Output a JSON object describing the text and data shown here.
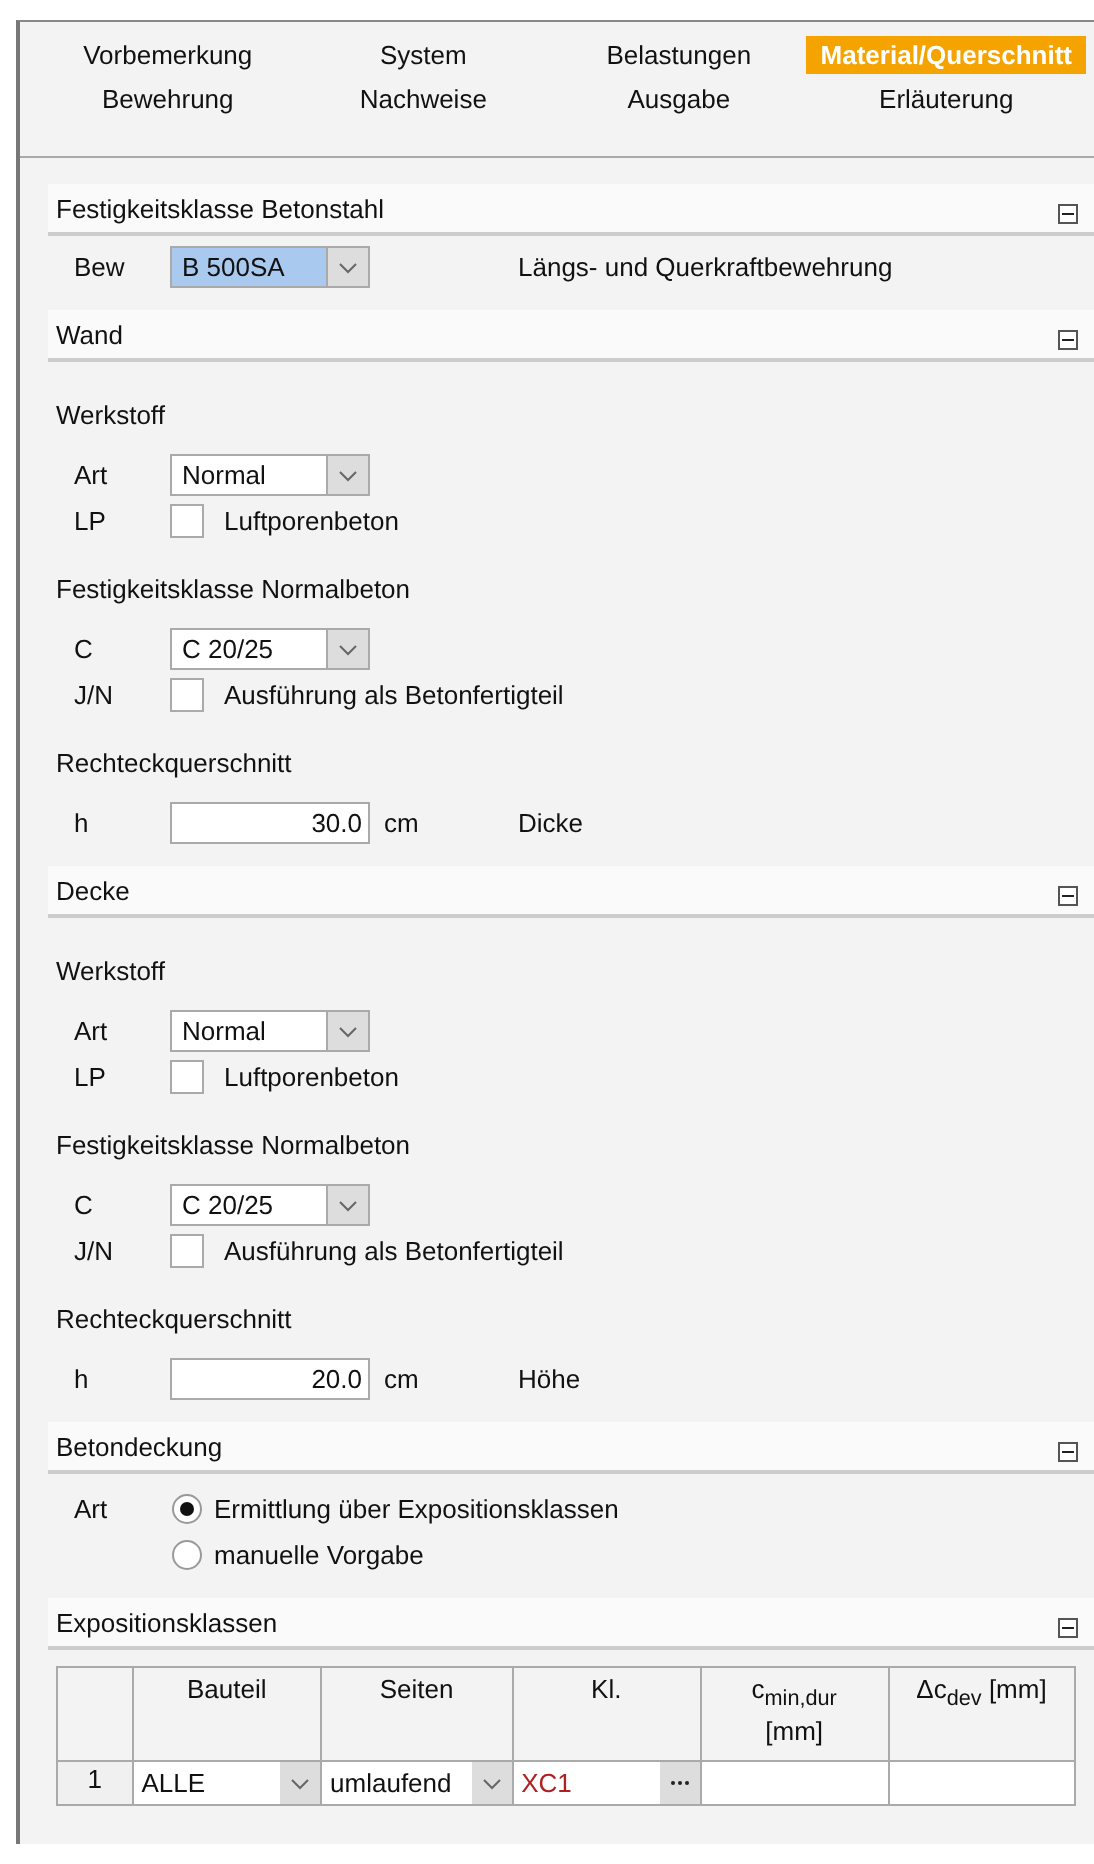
{
  "tabs": [
    {
      "label": "Vorbemerkung",
      "selected": false
    },
    {
      "label": "System",
      "selected": false
    },
    {
      "label": "Belastungen",
      "selected": false
    },
    {
      "label": "Material/Querschnitt",
      "selected": true
    },
    {
      "label": "Bewehrung",
      "selected": false
    },
    {
      "label": "Nachweise",
      "selected": false
    },
    {
      "label": "Ausgabe",
      "selected": false
    },
    {
      "label": "Erläuterung",
      "selected": false
    }
  ],
  "sections": [
    {
      "title": "Festigkeitsklasse Betonstahl",
      "expanded": true,
      "items": [
        {
          "kind": "select",
          "label": "Bew",
          "value": "B 500SA",
          "focused": true,
          "note": "Längs- und Querkraftbewehrung"
        }
      ]
    },
    {
      "title": "Wand",
      "expanded": true,
      "items": [
        {
          "kind": "heading",
          "text": "Werkstoff"
        },
        {
          "kind": "select",
          "label": "Art",
          "value": "Normal",
          "focused": false
        },
        {
          "kind": "checkbox",
          "label": "LP",
          "text": "Luftporenbeton",
          "checked": false
        },
        {
          "kind": "heading",
          "text": "Festigkeitsklasse Normalbeton"
        },
        {
          "kind": "select",
          "label": "C",
          "value": "C 20/25",
          "focused": false
        },
        {
          "kind": "checkbox",
          "label": "J/N",
          "text": "Ausführung als Betonfertigteil",
          "checked": false
        },
        {
          "kind": "heading",
          "text": "Rechteckquerschnitt"
        },
        {
          "kind": "number",
          "label": "h",
          "value": "30.0",
          "unit": "cm",
          "note": "Dicke"
        }
      ]
    },
    {
      "title": "Decke",
      "expanded": true,
      "items": [
        {
          "kind": "heading",
          "text": "Werkstoff"
        },
        {
          "kind": "select",
          "label": "Art",
          "value": "Normal",
          "focused": false
        },
        {
          "kind": "checkbox",
          "label": "LP",
          "text": "Luftporenbeton",
          "checked": false
        },
        {
          "kind": "heading",
          "text": "Festigkeitsklasse Normalbeton"
        },
        {
          "kind": "select",
          "label": "C",
          "value": "C 20/25",
          "focused": false
        },
        {
          "kind": "checkbox",
          "label": "J/N",
          "text": "Ausführung als Betonfertigteil",
          "checked": false
        },
        {
          "kind": "heading",
          "text": "Rechteckquerschnitt"
        },
        {
          "kind": "number",
          "label": "h",
          "value": "20.0",
          "unit": "cm",
          "note": "Höhe"
        }
      ]
    },
    {
      "title": "Betondeckung",
      "expanded": true,
      "items": [
        {
          "kind": "radio",
          "label": "Art",
          "options": [
            {
              "text": "Ermittlung über Expositionsklassen",
              "selected": true
            },
            {
              "text": "manuelle Vorgabe",
              "selected": false
            }
          ]
        }
      ]
    },
    {
      "title": "Expositionsklassen",
      "expanded": true,
      "items": [
        {
          "kind": "table",
          "columns": [
            "Bauteil",
            "Seiten",
            "Kl.",
            "c$_{min,dur}$ [mm]",
            "Δc$_{dev}$ [mm]"
          ],
          "rows": [
            {
              "number": "1",
              "cells": [
                {
                  "kind": "select",
                  "value": "ALLE"
                },
                {
                  "kind": "select",
                  "value": "umlaufend"
                },
                {
                  "kind": "picker",
                  "value": "XC1"
                },
                {
                  "kind": "blank"
                },
                {
                  "kind": "blank"
                }
              ]
            }
          ]
        }
      ]
    }
  ]
}
